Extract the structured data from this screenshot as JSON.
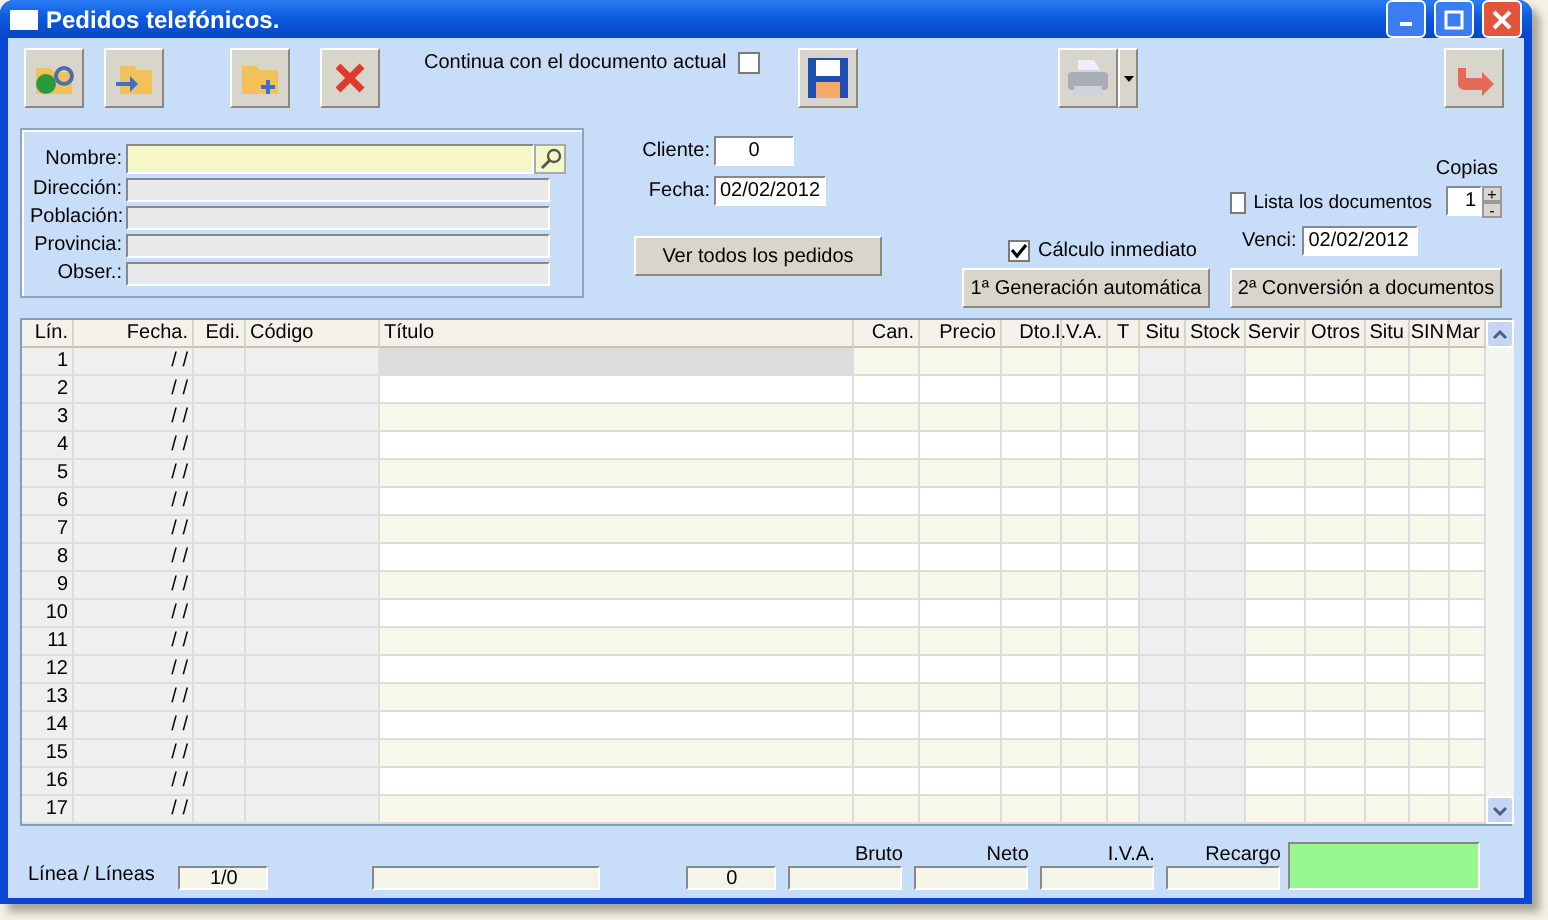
{
  "window": {
    "title": "Pedidos telefónicos."
  },
  "toolbar": {
    "continue_label": "Continua con el documento actual",
    "continue_checked": false
  },
  "customer": {
    "fields": [
      {
        "label": "Nombre:",
        "kind": "search"
      },
      {
        "label": "Dirección:",
        "kind": "plain"
      },
      {
        "label": "Población:",
        "kind": "plain"
      },
      {
        "label": "Provincia:",
        "kind": "plain"
      },
      {
        "label": "Obser.:",
        "kind": "plain"
      }
    ]
  },
  "cliente": {
    "label": "Cliente:",
    "value": "0"
  },
  "fecha": {
    "label": "Fecha:",
    "value": "02/02/2012"
  },
  "ver_todos_button": "Ver todos los pedidos",
  "calculo": {
    "label": "Cálculo inmediato",
    "checked": true
  },
  "generacion_button": "1ª Generación automática",
  "copias": {
    "label": "Copias",
    "value": "1",
    "up": "+",
    "down": "-"
  },
  "lista": {
    "label": "Lista los documentos",
    "checked": false
  },
  "venci": {
    "label": "Venci:",
    "value": "02/02/2012"
  },
  "conversion_button": "2ª Conversión a documentos",
  "table": {
    "columns": [
      "Lín.",
      "Fecha.",
      "Edi.",
      "Código",
      "Título",
      "Can.",
      "Precio",
      "Dto.",
      "I.V.A.",
      "T",
      "Situ",
      "Stock",
      "Servir",
      "Otros",
      "Situ",
      "SIN",
      "Mar"
    ],
    "rows": [
      {
        "lin": "1",
        "fecha": "/ /",
        "selected": true
      },
      {
        "lin": "2",
        "fecha": "/ /",
        "selected": false
      },
      {
        "lin": "3",
        "fecha": "/ /",
        "selected": false
      },
      {
        "lin": "4",
        "fecha": "/ /",
        "selected": false
      },
      {
        "lin": "5",
        "fecha": "/ /",
        "selected": false
      },
      {
        "lin": "6",
        "fecha": "/ /",
        "selected": false
      },
      {
        "lin": "7",
        "fecha": "/ /",
        "selected": false
      },
      {
        "lin": "8",
        "fecha": "/ /",
        "selected": false
      },
      {
        "lin": "9",
        "fecha": "/ /",
        "selected": false
      },
      {
        "lin": "10",
        "fecha": "/ /",
        "selected": false
      },
      {
        "lin": "11",
        "fecha": "/ /",
        "selected": false
      },
      {
        "lin": "12",
        "fecha": "/ /",
        "selected": false
      },
      {
        "lin": "13",
        "fecha": "/ /",
        "selected": false
      },
      {
        "lin": "14",
        "fecha": "/ /",
        "selected": false
      },
      {
        "lin": "15",
        "fecha": "/ /",
        "selected": false
      },
      {
        "lin": "16",
        "fecha": "/ /",
        "selected": false
      },
      {
        "lin": "17",
        "fecha": "/ /",
        "selected": false
      }
    ]
  },
  "footer": {
    "lines_label": "Línea / Líneas",
    "lines_value": "1/0",
    "count_value": "0",
    "totals": [
      {
        "label": "Bruto"
      },
      {
        "label": "Neto"
      },
      {
        "label": "I.V.A."
      },
      {
        "label": "Recargo"
      }
    ]
  }
}
